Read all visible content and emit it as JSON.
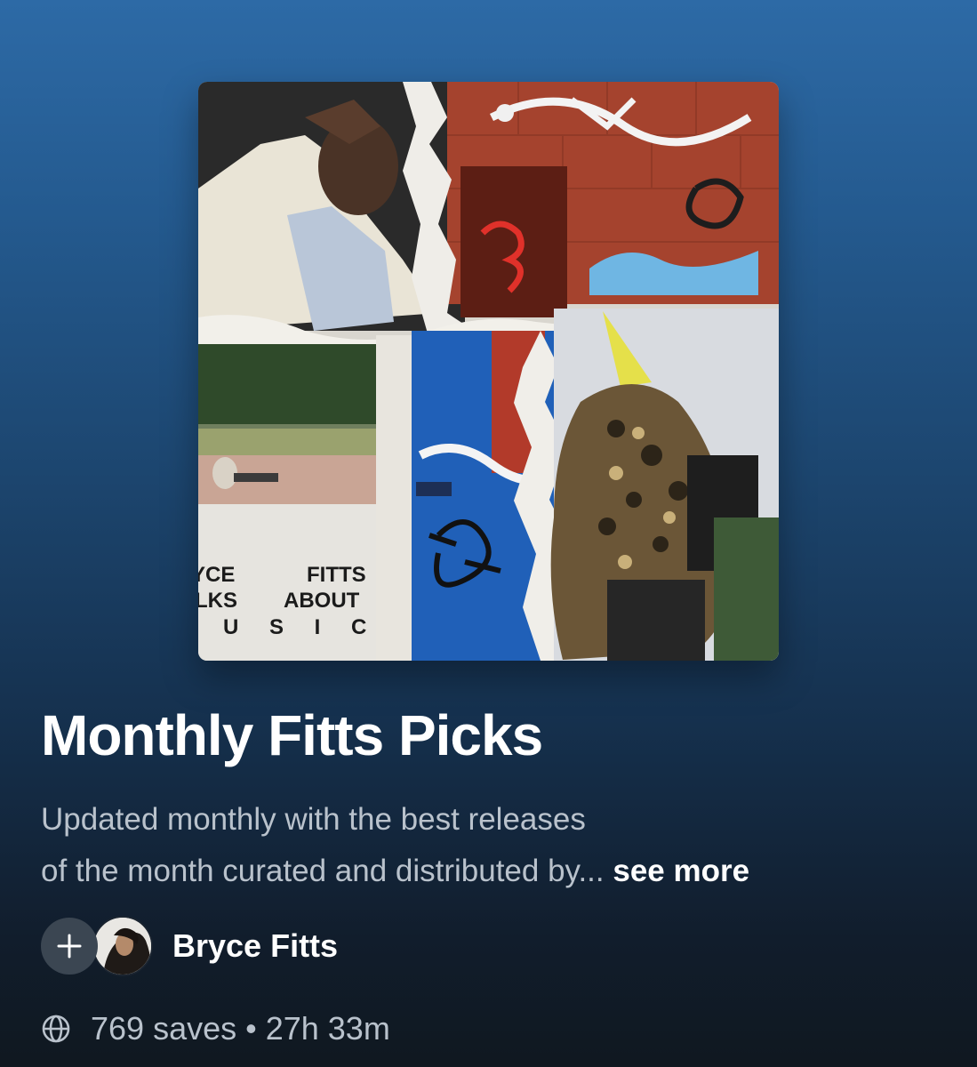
{
  "playlist": {
    "title": "Monthly Fitts Picks",
    "description_line1": "Updated monthly with the best releases",
    "description_line2": "of the month curated and distributed by...",
    "see_more_label": "see more",
    "cover_art": {
      "text_row1_left": "YCE",
      "text_row1_right": "FITTS",
      "text_row2_left": "LKS",
      "text_row2_right": "ABOUT",
      "text_row3": "U S I C"
    }
  },
  "owner": {
    "name": "Bryce Fitts",
    "add_icon": "plus-icon",
    "avatar_icon": "avatar"
  },
  "meta": {
    "visibility_icon": "globe-icon",
    "saves": "769 saves",
    "separator": "•",
    "duration": "27h 33m"
  },
  "colors": {
    "background_top": "#2d6aa6",
    "background_bottom": "#101820",
    "text_primary": "#ffffff",
    "text_secondary": "#b9c2cc",
    "add_button": "#3b4652"
  }
}
